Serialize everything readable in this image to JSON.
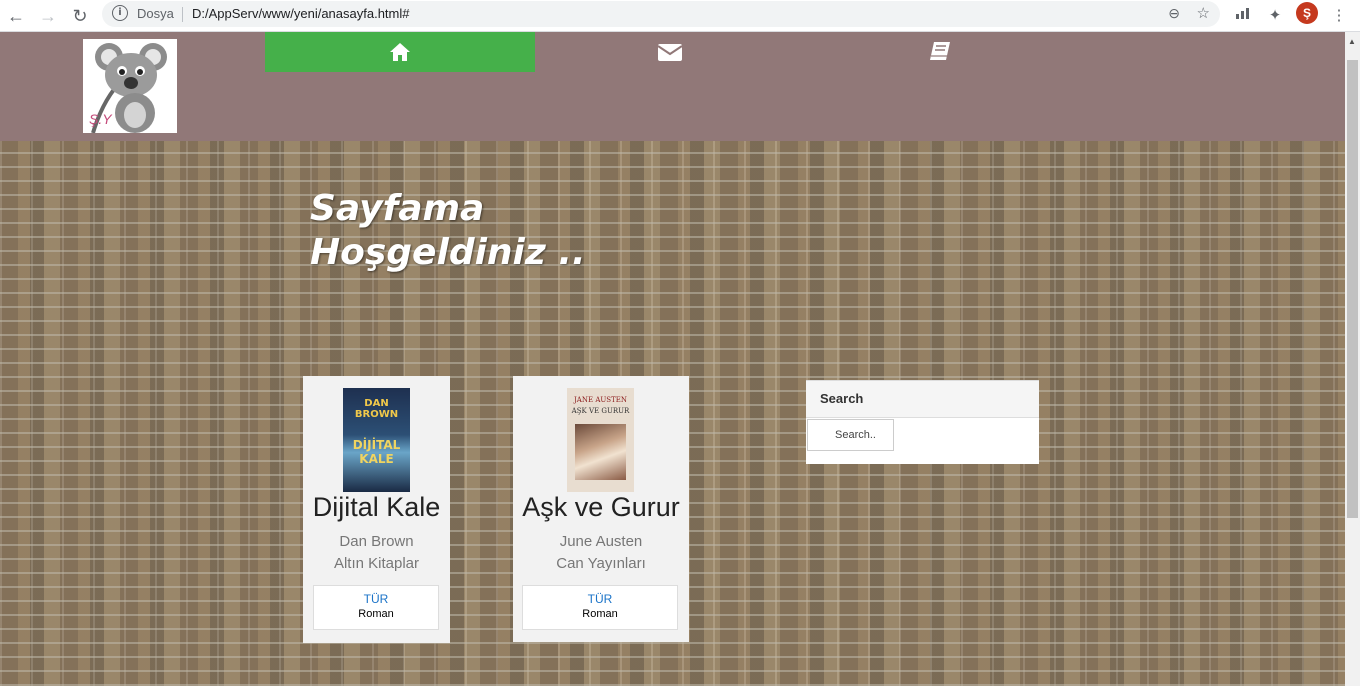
{
  "browser": {
    "scheme_label": "Dosya",
    "url": "D:/AppServ/www/yeni/anasayfa.html#",
    "profile_initial": "Ş"
  },
  "header": {
    "logo_text": "Ş.Y",
    "nav": [
      {
        "icon": "home-icon",
        "active": true
      },
      {
        "icon": "envelope-icon",
        "active": false
      },
      {
        "icon": "book-icon",
        "active": false
      }
    ],
    "active_color": "#45b04a",
    "background_color": "#917878"
  },
  "hero": {
    "line1": "Sayfama",
    "line2": "Hoşgeldiniz .."
  },
  "books": [
    {
      "title": "Dijital Kale",
      "author": "Dan Brown",
      "publisher": "Altın Kitaplar",
      "genre_label": "TÜR",
      "genre": "Roman",
      "cover_top": "DAN BROWN",
      "cover_main": "DİJİTAL KALE"
    },
    {
      "title": "Aşk ve Gurur",
      "author": "June Austen",
      "publisher": "Can Yayınları",
      "genre_label": "TÜR",
      "genre": "Roman",
      "cover_top": "JANE AUSTEN",
      "cover_main": "AŞK VE GURUR"
    }
  ],
  "search": {
    "title": "Search",
    "placeholder": "Search.."
  }
}
